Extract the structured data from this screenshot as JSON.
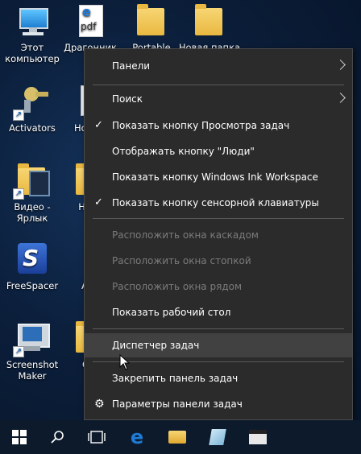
{
  "desktop_icons": [
    {
      "label": "Этот компьютер",
      "icon": "computer-icon"
    },
    {
      "label": "Драгонник ка",
      "icon": "pdf-icon"
    },
    {
      "label": "Portable",
      "icon": "folder-icon"
    },
    {
      "label": "Новая папка",
      "icon": "folder-icon"
    },
    {
      "label": "Activators",
      "icon": "keys-icon"
    },
    {
      "label": "Но тек",
      "icon": "document-icon"
    },
    {
      "label": "Видео - Ярлык",
      "icon": "video-icon"
    },
    {
      "label": "Нова",
      "icon": "folder-icon"
    },
    {
      "label": "FreeSpacer",
      "icon": "freespacer-icon"
    },
    {
      "label": "Al 1",
      "icon": "app-icon"
    },
    {
      "label": "Screenshot Maker",
      "icon": "screenshot-icon"
    },
    {
      "label": "О р",
      "icon": "folder-icon"
    }
  ],
  "context_menu": {
    "items": [
      {
        "label": "Панели",
        "submenu": true
      },
      {
        "label": "Поиск",
        "submenu": true
      },
      {
        "label": "Показать кнопку Просмотра задач",
        "checked": true
      },
      {
        "label": "Отображать кнопку \"Люди\""
      },
      {
        "label": "Показать кнопку Windows Ink Workspace"
      },
      {
        "label": "Показать кнопку сенсорной клавиатуры",
        "checked": true
      },
      {
        "label": "Расположить окна каскадом",
        "disabled": true
      },
      {
        "label": "Расположить окна стопкой",
        "disabled": true
      },
      {
        "label": "Расположить окна рядом",
        "disabled": true
      },
      {
        "label": "Показать рабочий стол"
      },
      {
        "label": "Диспетчер задач",
        "hover": true
      },
      {
        "label": "Закрепить панель задач"
      },
      {
        "label": "Параметры панели задач",
        "icon": "gear-icon"
      }
    ],
    "check_glyph": "✓"
  },
  "taskbar": {
    "buttons": [
      "windows-start-icon",
      "search-icon",
      "task-view-icon",
      "edge-icon",
      "file-explorer-icon",
      "notepad-icon",
      "media-icon"
    ]
  },
  "colors": {
    "menu_bg": "#2b2b2b",
    "menu_hover": "#414141",
    "disabled_text": "#7b7b7b",
    "edge_blue": "#1e7bd6"
  }
}
